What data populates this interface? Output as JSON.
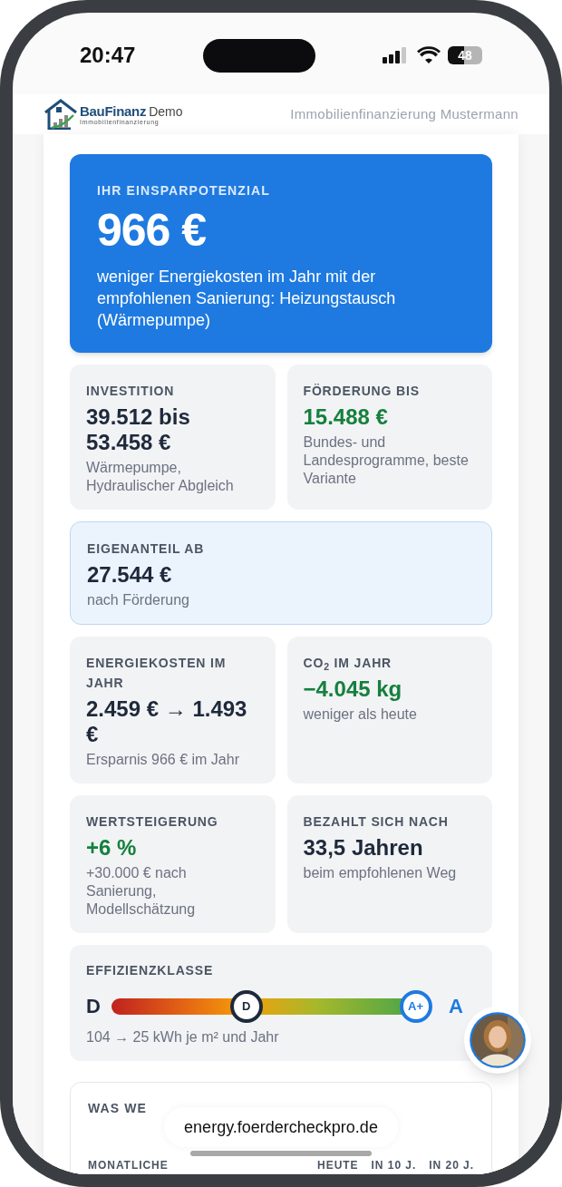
{
  "status_bar": {
    "time": "20:47",
    "battery": "48"
  },
  "header": {
    "logo_main": "BauFinanz",
    "logo_suffix": "Demo",
    "logo_tagline": "Immobilienfinanzierung",
    "title": "Immobilienfinanzierung Mustermann"
  },
  "hero": {
    "label": "IHR EINSPARPOTENZIAL",
    "value": "966 €",
    "text": "weniger Energiekosten im Jahr mit der empfohlenen Sanierung: Heizungstausch (Wärmepumpe)"
  },
  "cards": [
    {
      "kind": "half",
      "label": "INVESTITION",
      "value": "39.512 bis 53.458 €",
      "color": "#1e293b",
      "note": "Wärmepumpe, Hydraulischer Abgleich"
    },
    {
      "kind": "half",
      "label": "FÖRDERUNG BIS",
      "value": "15.488 €",
      "color": "#15803d",
      "note": "Bundes- und Landesprogramme, beste Variante"
    },
    {
      "kind": "full",
      "label": "EIGENANTEIL AB",
      "value": "27.544 €",
      "color": "#1e293b",
      "note": "nach Förderung"
    },
    {
      "kind": "half",
      "label": "ENERGIEKOSTEN IM JAHR",
      "value": "2.459 € → 1.493 €",
      "color": "#1e293b",
      "note": "Ersparnis 966 € im Jahr"
    },
    {
      "kind": "half",
      "label": "CO$_{2}$ IM JAHR",
      "value": "−4.045 kg",
      "color": "#15803d",
      "note": "weniger als heute"
    },
    {
      "kind": "half",
      "label": "WERTSTEIGERUNG",
      "value": "+6 %",
      "color": "#15803d",
      "note": "+30.000 € nach Sanierung, Modellschätzung"
    },
    {
      "kind": "half",
      "label": "BEZAHLT SICH NACH",
      "value": "33,5 Jahren",
      "color": "#1e293b",
      "note": "beim empfohlenen Weg"
    }
  ],
  "efficiency": {
    "label": "EFFIZIENZKLASSE",
    "from": "D",
    "to": "A",
    "current": {
      "label": "D",
      "level": 0.43
    },
    "target": {
      "label": "A+",
      "level": 0.97
    },
    "note": "104 → 25 kWh je m² und Jahr"
  },
  "outlook": {
    "title": "WAS WE",
    "row_label": "MONATLICHE",
    "columns": [
      "HEUTE",
      "IN 10 J.",
      "IN 20 J."
    ]
  },
  "browser": {
    "url": "energy.foerdercheckpro.de"
  }
}
